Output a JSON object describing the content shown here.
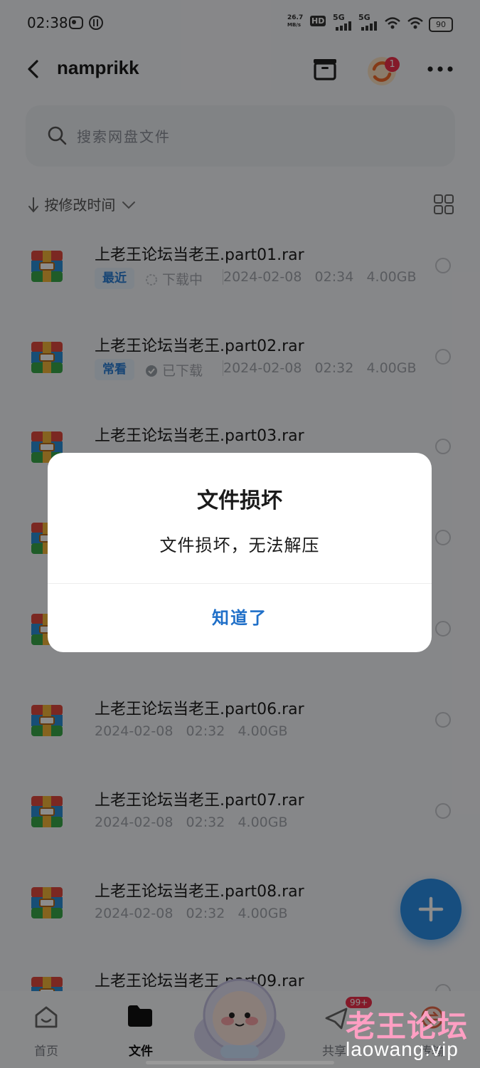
{
  "status_bar": {
    "time": "02:38",
    "net_speed_value": "26.7",
    "net_speed_unit": "MB/s",
    "hd_label": "HD",
    "sim1": "5G",
    "sim2": "5G",
    "battery": "90"
  },
  "header": {
    "title": "namprikk",
    "notification_count": "1"
  },
  "search": {
    "placeholder": "搜索网盘文件"
  },
  "sort": {
    "label": "按修改时间"
  },
  "files": [
    {
      "name": "上老王论坛当老王.part01.rar",
      "tag": "最近",
      "status": "下载中",
      "date": "2024-02-08",
      "time": "02:34",
      "size": "4.00GB"
    },
    {
      "name": "上老王论坛当老王.part02.rar",
      "tag": "常看",
      "status": "已下载",
      "date": "2024-02-08",
      "time": "02:32",
      "size": "4.00GB"
    },
    {
      "name": "上老王论坛当老王.part03.rar"
    },
    {
      "name": ""
    },
    {
      "name": ""
    },
    {
      "name": "上老王论坛当老王.part06.rar",
      "date": "2024-02-08",
      "time": "02:32",
      "size": "4.00GB"
    },
    {
      "name": "上老王论坛当老王.part07.rar",
      "date": "2024-02-08",
      "time": "02:32",
      "size": "4.00GB"
    },
    {
      "name": "上老王论坛当老王.part08.rar",
      "date": "2024-02-08",
      "time": "02:32",
      "size": "4.00GB"
    },
    {
      "name": "上老王论坛当老王.part09.rar"
    }
  ],
  "dialog": {
    "title": "文件损坏",
    "message": "文件损坏，无法解压",
    "button": "知道了"
  },
  "nav": {
    "home": "首页",
    "files": "文件",
    "share": "共享",
    "share_badge": "99+",
    "transfer": "传输"
  },
  "watermark": {
    "cn": "老王论坛",
    "en": "laowang.vip"
  },
  "colors": {
    "accent": "#2a8ee8",
    "dialog_button": "#1f6fc8",
    "tag_bg": "#e6f0fb"
  }
}
